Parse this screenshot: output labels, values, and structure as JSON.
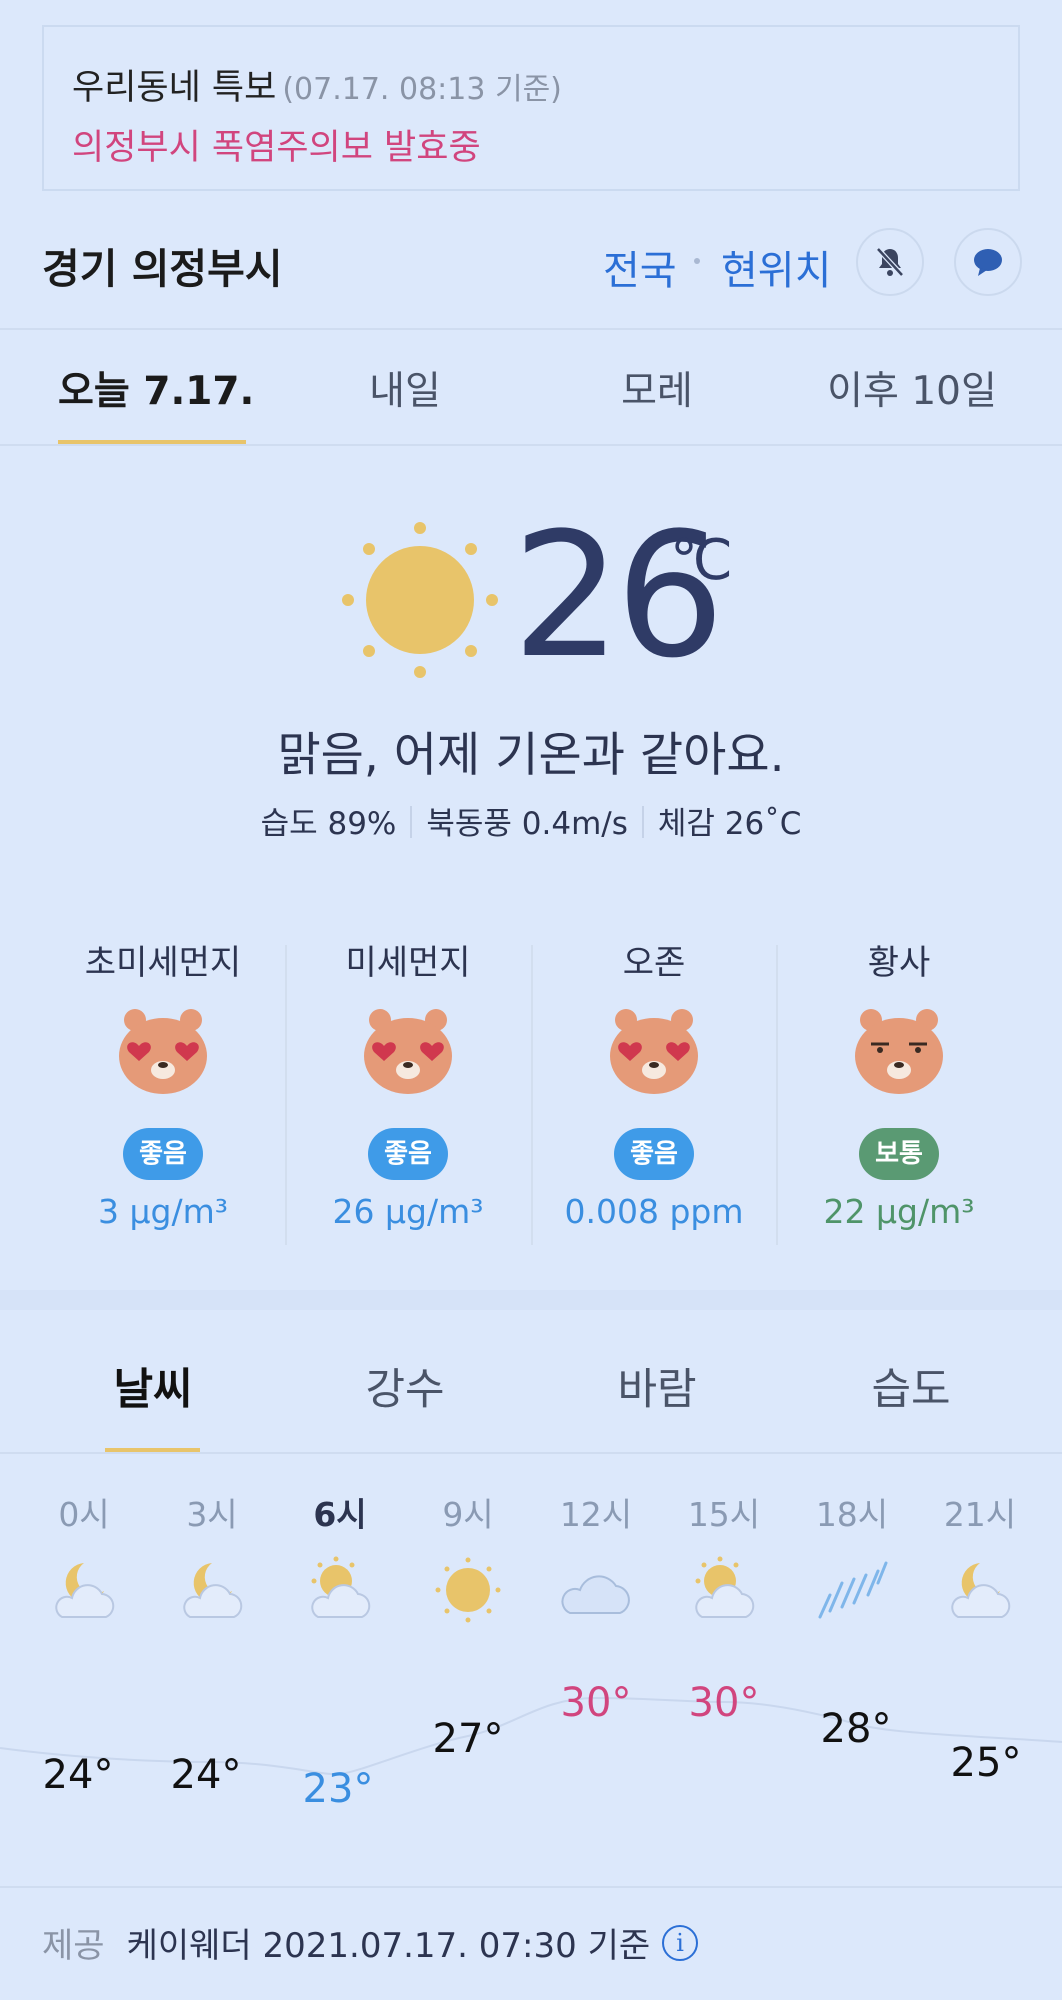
{
  "alert": {
    "title": "우리동네 특보",
    "time": "(07.17. 08:13 기준)",
    "message": "의정부시 폭염주의보 발효중"
  },
  "location": {
    "name": "경기 의정부시",
    "nav_national": "전국",
    "nav_current": "현위치",
    "icons": [
      "bell-off-icon",
      "chat-icon"
    ]
  },
  "day_tabs": [
    "오늘 7.17.",
    "내일",
    "모레",
    "이후 10일"
  ],
  "current": {
    "icon": "sun-icon",
    "temp": "26",
    "unit": "℃",
    "summary": "맑음, 어제 기온과 같아요.",
    "humidity": "습도 89%",
    "wind": "북동풍 0.4m/s",
    "feels_like": "체감 26˚C"
  },
  "air_quality": [
    {
      "name": "초미세먼지",
      "status": "좋음",
      "value": "3 μg/m³",
      "face": "heart-eyes-face-icon",
      "color": "#3f9be8"
    },
    {
      "name": "미세먼지",
      "status": "좋음",
      "value": "26 μg/m³",
      "face": "heart-eyes-face-icon",
      "color": "#3f9be8"
    },
    {
      "name": "오존",
      "status": "좋음",
      "value": "0.008 ppm",
      "face": "heart-eyes-face-icon",
      "color": "#3f9be8"
    },
    {
      "name": "황사",
      "status": "보통",
      "value": "22 μg/m³",
      "face": "neutral-face-icon",
      "color": "#5a9a73"
    }
  ],
  "forecast_tabs": [
    "날씨",
    "강수",
    "바람",
    "습도"
  ],
  "hourly": [
    {
      "time": "0시",
      "icon": "moon-cloud-icon",
      "temp": "24°"
    },
    {
      "time": "3시",
      "icon": "moon-cloud-icon",
      "temp": "24°"
    },
    {
      "time": "6시",
      "icon": "sun-cloud-icon",
      "temp": "23°"
    },
    {
      "time": "9시",
      "icon": "sun-icon",
      "temp": "27°"
    },
    {
      "time": "12시",
      "icon": "cloud-icon",
      "temp": "30°"
    },
    {
      "time": "15시",
      "icon": "sun-cloud-icon",
      "temp": "30°"
    },
    {
      "time": "18시",
      "icon": "rain-icon",
      "temp": "28°"
    },
    {
      "time": "21시",
      "icon": "moon-cloud-icon",
      "temp": "25°"
    }
  ],
  "footer": {
    "label": "제공",
    "text": "케이웨더 2021.07.17. 07:30 기준",
    "icon": "info-icon"
  },
  "colors": {
    "background": "#dce8fb",
    "accent_blue": "#2b6fd6",
    "alert_pink": "#d1457e",
    "tab_underline": "#e8c46a",
    "sun": "#e8c46a",
    "temp_text": "#2f3b66"
  }
}
